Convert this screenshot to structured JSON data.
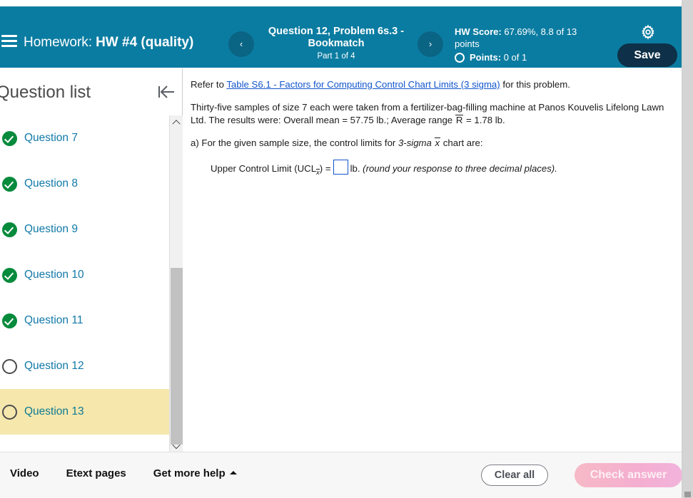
{
  "header": {
    "menu_icon": "hamburger-icon",
    "homework_label": "Homework:",
    "homework_name": "HW #4 (quality)",
    "prev_icon": "‹",
    "next_icon": "›",
    "question_title": "Question 12, Problem 6s.3 - Bookmatch",
    "question_part": "Part 1 of 4",
    "hw_score_label": "HW Score:",
    "hw_score_value": "67.69%, 8.8 of 13 points",
    "points_label": "Points:",
    "points_value": "0 of 1",
    "settings_icon": "gear-icon",
    "save_label": "Save",
    "bg_color": "#0b7ca1",
    "nav_btn_color": "#0a6484",
    "save_btn_color": "#0e3048"
  },
  "sidebar": {
    "title": "Question list",
    "collapse_icon": "collapse-left-icon",
    "active_highlight_color": "#f6e7ad",
    "link_color": "#1179a8",
    "done_color": "#068a3c",
    "items": [
      {
        "label": "Question 7",
        "status": "done",
        "active": false
      },
      {
        "label": "Question 8",
        "status": "done",
        "active": false
      },
      {
        "label": "Question 9",
        "status": "done",
        "active": false
      },
      {
        "label": "Question 10",
        "status": "done",
        "active": false
      },
      {
        "label": "Question 11",
        "status": "done",
        "active": false
      },
      {
        "label": "Question 12",
        "status": "open",
        "active": false
      },
      {
        "label": "Question 13",
        "status": "open",
        "active": true
      }
    ]
  },
  "content": {
    "refer_prefix": "Refer to ",
    "refer_link": "Table S6.1 - Factors for Computing Control Chart Limits (3 sigma)",
    "refer_suffix": " for this problem.",
    "problem_line1": "Thirty-five samples of size 7 each were taken from a fertilizer-bag-filling machine at Panos Kouvelis Lifelong Lawn",
    "problem_line2_a": "Ltd. The results were: Overall mean = 57.75 lb.; Average range ",
    "problem_r_symbol": "R",
    "problem_line2_b": " = 1.78 lb.",
    "part_a_prefix": "a) For the given sample size, the control limits for ",
    "part_a_italic": "3-sigma",
    "part_a_xbar": "x",
    "part_a_suffix": " chart are:",
    "ucl_label_a": "Upper Control Limit (UCL",
    "ucl_sub": "x",
    "ucl_label_b": ") =",
    "ucl_value": "",
    "ucl_unit": "lb.",
    "ucl_hint": "(round your response to three decimal places).",
    "answer_box_border": "#1155cc",
    "link_color": "#1155cc"
  },
  "footer": {
    "links": [
      {
        "label": "Video",
        "caret": false
      },
      {
        "label": "Etext pages",
        "caret": false
      },
      {
        "label": "Get more help",
        "caret": true
      }
    ],
    "clear_all_label": "Clear all",
    "check_answer_label": "Check answer",
    "check_answer_color": "#f4aed0"
  }
}
